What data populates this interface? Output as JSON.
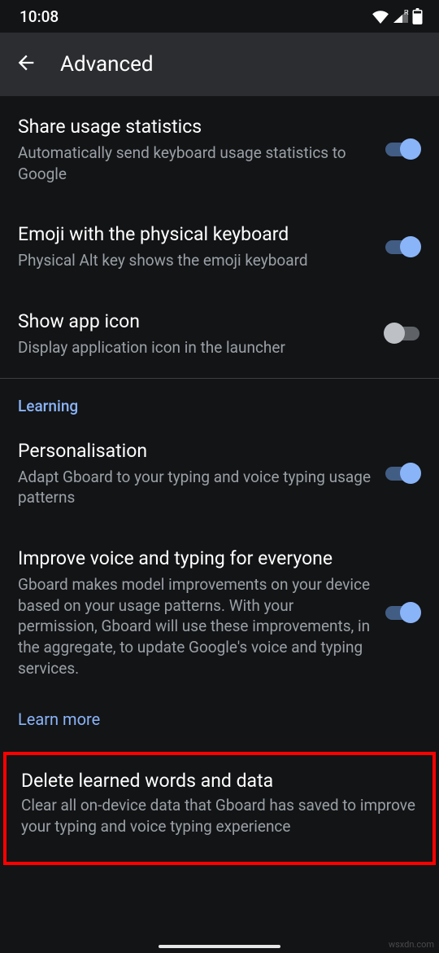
{
  "status": {
    "time": "10:08"
  },
  "appbar": {
    "title": "Advanced"
  },
  "items": [
    {
      "title": "Share usage statistics",
      "sub": "Automatically send keyboard usage statistics to Google",
      "on": true
    },
    {
      "title": "Emoji with the physical keyboard",
      "sub": "Physical Alt key shows the emoji keyboard",
      "on": true
    },
    {
      "title": "Show app icon",
      "sub": "Display application icon in the launcher",
      "on": false
    }
  ],
  "section": "Learning",
  "learning": [
    {
      "title": "Personalisation",
      "sub": "Adapt Gboard to your typing and voice typing usage patterns",
      "on": true
    },
    {
      "title": "Improve voice and typing for everyone",
      "sub": "Gboard makes model improvements on your device based on your usage patterns. With your permission, Gboard will use these improvements, in the aggregate, to update Google's voice and typing services.",
      "on": true
    }
  ],
  "learn_more": "Learn more",
  "delete": {
    "title": "Delete learned words and data",
    "sub": "Clear all on-device data that Gboard has saved to improve your typing and voice typing experience"
  },
  "watermark": "wsxdn.com"
}
